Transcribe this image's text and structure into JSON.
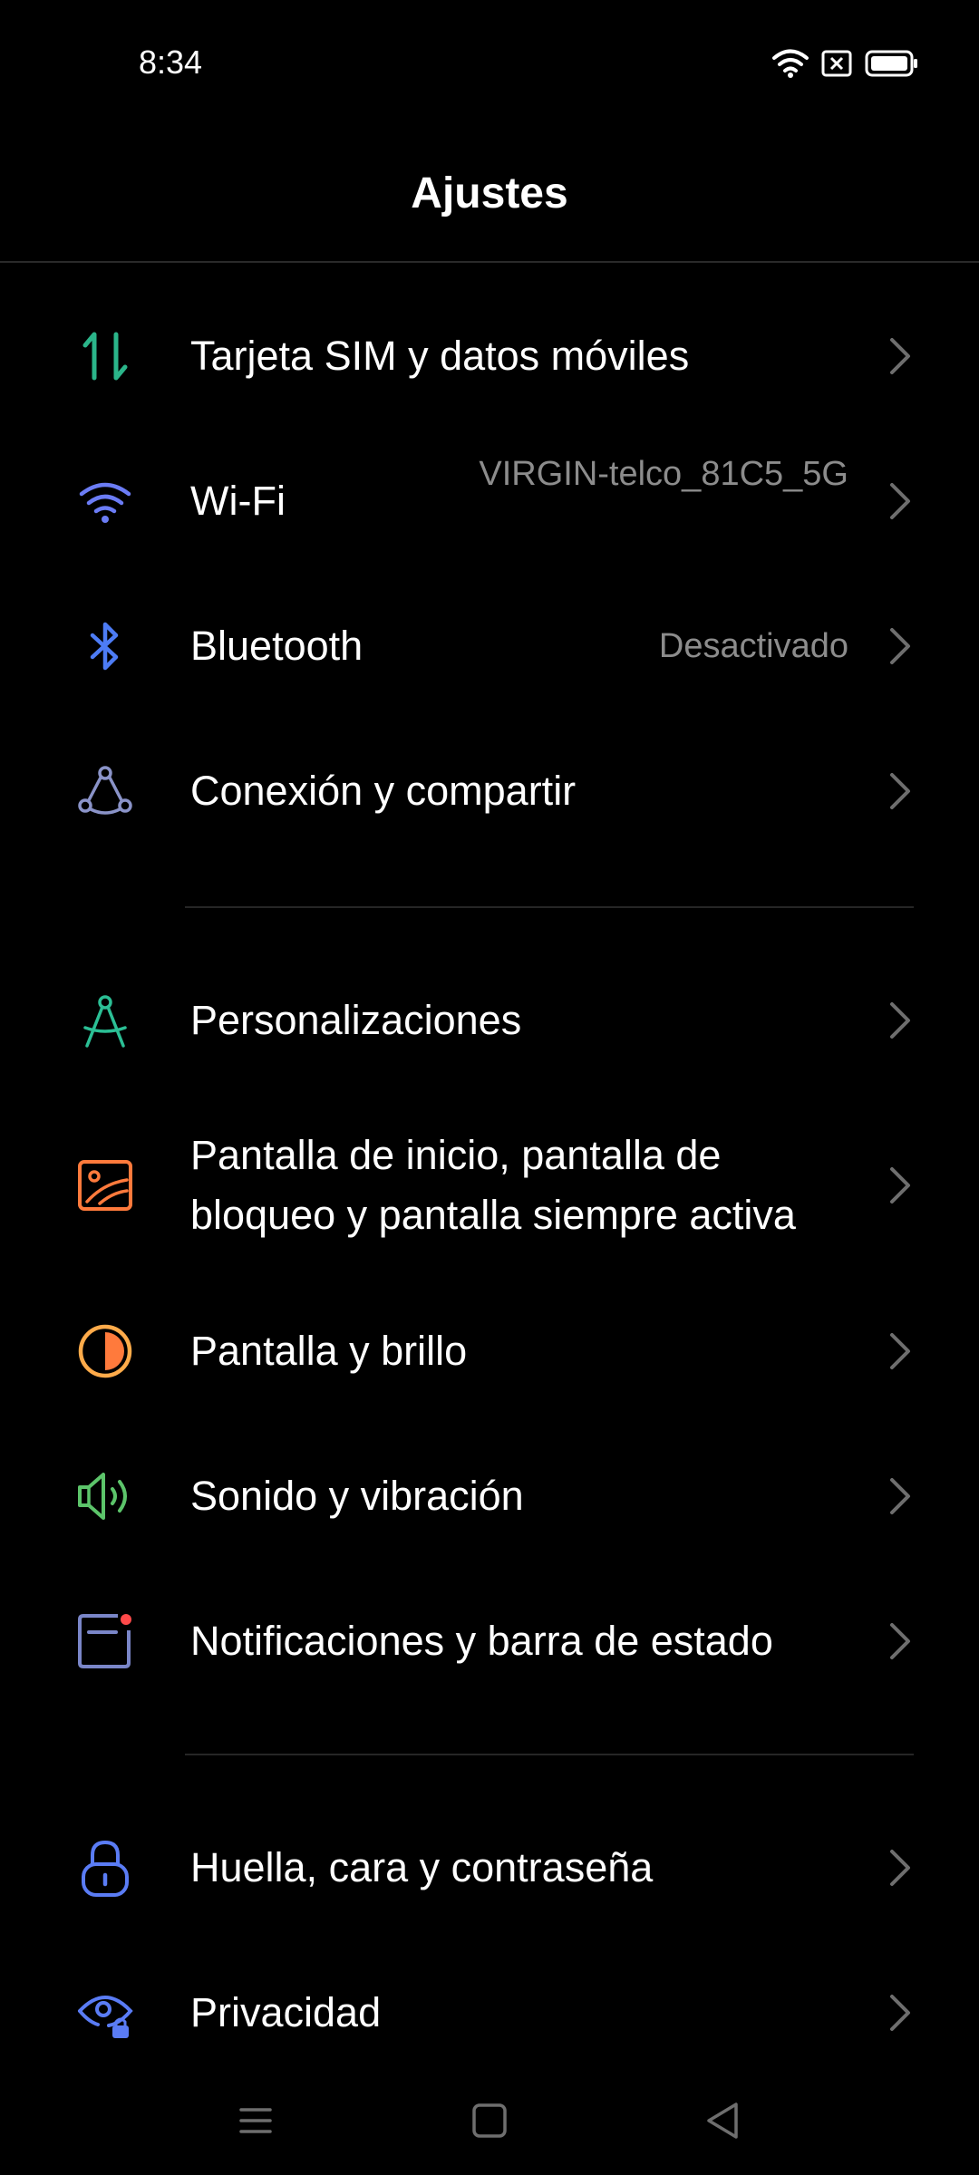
{
  "status_bar": {
    "time": "8:34",
    "icons": [
      "wifi-icon",
      "no-sim-icon",
      "battery-icon"
    ]
  },
  "header": {
    "title": "Ajustes"
  },
  "settings": [
    {
      "label": "Tarjeta SIM y datos móviles",
      "value": "",
      "icon": "sim-data-icon",
      "icon_color": "#2bb58a"
    },
    {
      "label": "Wi-Fi",
      "value": "VIRGIN-telco_81C5_5G",
      "icon": "wifi-icon",
      "icon_color": "#6b7cf5"
    },
    {
      "label": "Bluetooth",
      "value": "Desactivado",
      "icon": "bluetooth-icon",
      "icon_color": "#4d7cf5"
    },
    {
      "label": "Conexión y compartir",
      "value": "",
      "icon": "connection-sharing-icon",
      "icon_color": "#8a93c8"
    },
    {
      "label": "Personalizaciones",
      "value": "",
      "icon": "compass-icon",
      "icon_color": "#2bbf95"
    },
    {
      "label": "Pantalla de inicio, pantalla de bloqueo y pantalla siempre activa",
      "value": "",
      "icon": "wallpaper-icon",
      "icon_color": "#ff7a3c"
    },
    {
      "label": "Pantalla y brillo",
      "value": "",
      "icon": "brightness-icon",
      "icon_color": "#ffab4a"
    },
    {
      "label": "Sonido y vibración",
      "value": "",
      "icon": "speaker-icon",
      "icon_color": "#5cc46a"
    },
    {
      "label": "Notificaciones y barra de estado",
      "value": "",
      "icon": "notification-icon",
      "icon_color": "#7a86c8"
    },
    {
      "label": "Huella, cara y contraseña",
      "value": "",
      "icon": "lock-icon",
      "icon_color": "#5a7cf5"
    },
    {
      "label": "Privacidad",
      "value": "",
      "icon": "privacy-eye-icon",
      "icon_color": "#5a7cf5"
    }
  ],
  "nav_bar": [
    "menu-icon",
    "home-icon",
    "back-icon"
  ],
  "colors": {
    "background": "#000000",
    "text": "#ffffff",
    "secondary_text": "#8c8c8c",
    "chevron": "#6e6e6e"
  }
}
